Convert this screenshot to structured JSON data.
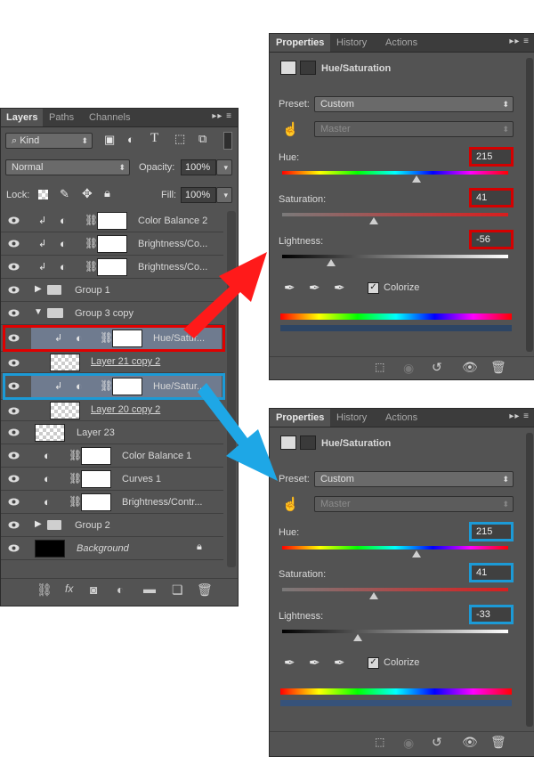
{
  "layers_panel": {
    "tabs": [
      "Layers",
      "Paths",
      "Channels"
    ],
    "kind_label": "Kind",
    "blend_mode": "Normal",
    "opacity_label": "Opacity:",
    "opacity_value": "100%",
    "lock_label": "Lock:",
    "fill_label": "Fill:",
    "fill_value": "100%",
    "layers": [
      {
        "name": "Color Balance 2"
      },
      {
        "name": "Brightness/Co..."
      },
      {
        "name": "Brightness/Co..."
      },
      {
        "name": "Group 1"
      },
      {
        "name": "Group 3 copy"
      },
      {
        "name": "Hue/Satur..."
      },
      {
        "name": "Layer 21 copy 2"
      },
      {
        "name": "Hue/Satur..."
      },
      {
        "name": "Layer 20 copy 2"
      },
      {
        "name": "Layer 23"
      },
      {
        "name": "Color Balance 1"
      },
      {
        "name": "Curves 1"
      },
      {
        "name": "Brightness/Contr..."
      },
      {
        "name": "Group 2"
      },
      {
        "name": "Background"
      }
    ]
  },
  "properties_top": {
    "tabs": [
      "Properties",
      "History",
      "Actions"
    ],
    "title": "Hue/Saturation",
    "preset_label": "Preset:",
    "preset_value": "Custom",
    "channel_value": "Master",
    "hue_label": "Hue:",
    "hue_value": "215",
    "saturation_label": "Saturation:",
    "saturation_value": "41",
    "lightness_label": "Lightness:",
    "lightness_value": "-56",
    "colorize_label": "Colorize",
    "colorize_checked": true,
    "highlight_color": "#d40000"
  },
  "properties_bottom": {
    "tabs": [
      "Properties",
      "History",
      "Actions"
    ],
    "title": "Hue/Saturation",
    "preset_label": "Preset:",
    "preset_value": "Custom",
    "channel_value": "Master",
    "hue_label": "Hue:",
    "hue_value": "215",
    "saturation_label": "Saturation:",
    "saturation_value": "41",
    "lightness_label": "Lightness:",
    "lightness_value": "-33",
    "colorize_label": "Colorize",
    "colorize_checked": true,
    "highlight_color": "#1c9ad6"
  },
  "arrows": {
    "red": "#ff1a1a",
    "blue": "#1ea7e6"
  }
}
